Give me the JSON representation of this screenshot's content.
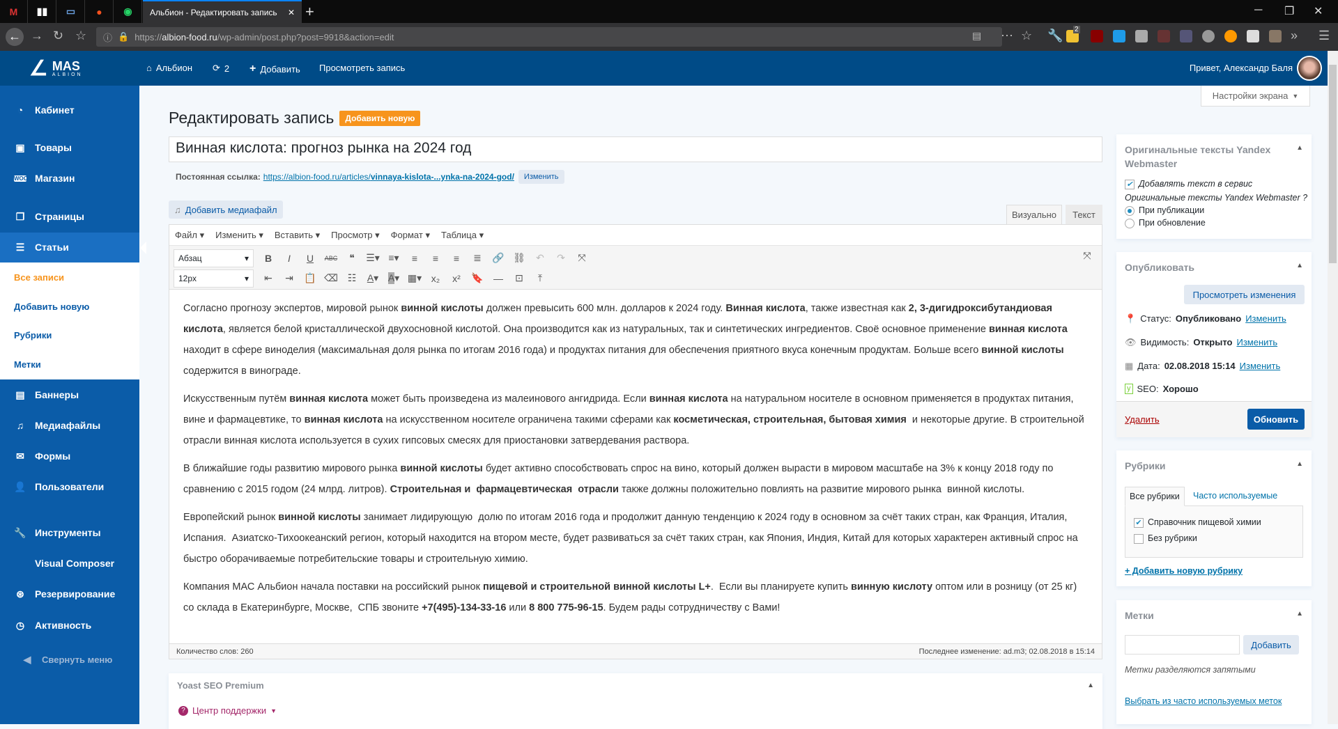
{
  "browser": {
    "tab_title": "Альбион - Редактировать запись",
    "url_prefix": "https://",
    "url_host": "albion-food.ru",
    "url_path": "/wp-admin/post.php?post=9918&action=edit",
    "ext_badge": "2"
  },
  "adminbar": {
    "logo_main": "MAS",
    "logo_sub": "ALBION",
    "site": "Альбион",
    "updates": "2",
    "add": "Добавить",
    "view": "Просмотреть запись",
    "greeting": "Привет, Александр Баля"
  },
  "sidebar": {
    "items": [
      {
        "label": "Кабинет"
      },
      {
        "label": "Товары"
      },
      {
        "label": "Магазин"
      },
      {
        "label": "Страницы"
      },
      {
        "label": "Статьи"
      },
      {
        "label": "Баннеры"
      },
      {
        "label": "Медиафайлы"
      },
      {
        "label": "Формы"
      },
      {
        "label": "Пользователи"
      },
      {
        "label": "Инструменты"
      },
      {
        "label": "Visual Composer"
      },
      {
        "label": "Резервирование"
      },
      {
        "label": "Активность"
      }
    ],
    "submenu": [
      "Все записи",
      "Добавить новую",
      "Рубрики",
      "Метки"
    ],
    "collapse": "Свернуть меню"
  },
  "screen_options": "Настройки экрана",
  "page": {
    "title": "Редактировать запись",
    "add_new": "Добавить новую",
    "post_title": "Винная кислота: прогноз рынка на 2024 год",
    "permalink_label": "Постоянная ссылка:",
    "permalink_base": "https://albion-food.ru/articles/",
    "permalink_slug": "vinnaya-kislota-...ynka-na-2024-god/",
    "permalink_edit": "Изменить",
    "add_media": "Добавить медиафайл"
  },
  "editor": {
    "tab_visual": "Визуально",
    "tab_text": "Текст",
    "menus": [
      "Файл",
      "Изменить",
      "Вставить",
      "Просмотр",
      "Формат",
      "Таблица"
    ],
    "format": "Абзац",
    "fontsize": "12px",
    "word_count": "Количество слов: 260",
    "last_edit": "Последнее изменение: ad.m3; 02.08.2018 в 15:14",
    "paragraphs": [
      "Согласно прогнозу экспертов, мировой рынок <b>винной кислоты</b> должен превысить 600 млн. долларов к 2024 году. <b>Винная кислота</b>, также известная как <b>2, 3-дигидроксибутандиовая кислота</b>, является белой кристаллической двухосновной кислотой. Она производится как из натуральных, так и синтетических ингредиентов. Своё основное применение <b>винная кислота</b> находит в сфере виноделия (максимальная доля рынка по итогам 2016 года) и продуктах питания для обеспечения приятного вкуса конечным продуктам. Больше всего <b>винной кислоты</b> содержится в винограде.",
      "Искусственным путём <b>винная кислота</b> может быть произведена из малеинового ангидрида. Если <b>винная кислота</b> на натуральном носителе в основном применяется в продуктах питания, вине и фармацевтике, то <b>винная кислота</b> на искусственном носителе ограничена такими сферами как <b>косметическая, строительная, бытовая химия</b>&nbsp; и некоторые другие. В строительной отрасли винная кислота используется в сухих гипсовых смесях для приостановки затвердевания раствора.",
      "В ближайшие годы развитию мирового рынка <b>винной кислоты</b> будет активно способствовать спрос на вино, который должен вырасти в мировом масштабе на 3% к концу 2018 году по сравнению с 2015 годом (24 млрд. литров). <b>Строительная и&nbsp; фармацевтическая&nbsp; отрасли</b> также должны положительно повлиять на развитие мирового рынка&nbsp; винной кислоты.",
      "Европейский рынок <b>винной кислоты</b> занимает лидирующую&nbsp; долю по итогам 2016 года и продолжит данную тенденцию к 2024 году в основном за счёт таких стран, как Франция, Италия, Испания.&nbsp; Азиатско-Тихоокеанский регион, который находится на втором месте, будет развиваться за счёт таких стран, как Япония, Индия, Китай для которых характерен активный спрос на быстро оборачиваемые потребительские товары и строительную химию.",
      "Компания МАС Альбион начала поставки на российский рынок <b>пищевой и строительной винной кислоты L+</b>.&nbsp; Если вы планируете купить <b>винную кислоту</b> оптом или в розницу (от 25 кг) со склада в Екатеринбурге, Москве,&nbsp; СПБ звоните <b>+7(495)-134-33-16</b> или <b>8 800 775-96-15</b>. Будем рады сотрудничеству с Вами!"
    ]
  },
  "yoast": {
    "title": "Yoast SEO Premium",
    "support": "Центр поддержки"
  },
  "yandex": {
    "title": "Оригинальные тексты Yandex Webmaster",
    "checkbox": "Добавлять текст в сервис",
    "question": "Оригинальные тексты Yandex Webmaster ?",
    "opt1": "При публикации",
    "opt2": "При обновление"
  },
  "publish": {
    "title": "Опубликовать",
    "preview": "Просмотреть изменения",
    "status_label": "Статус:",
    "status": "Опубликовано",
    "visibility_label": "Видимость:",
    "visibility": "Открыто",
    "date_label": "Дата:",
    "date": "02.08.2018 15:14",
    "change": "Изменить",
    "seo_label": "SEO:",
    "seo": "Хорошо",
    "delete": "Удалить",
    "update": "Обновить"
  },
  "categories": {
    "title": "Рубрики",
    "tab_all": "Все рубрики",
    "tab_popular": "Часто используемые",
    "items": [
      {
        "label": "Справочник пищевой химии",
        "checked": true
      },
      {
        "label": "Без рубрики",
        "checked": false
      }
    ],
    "add": "+ Добавить новую рубрику"
  },
  "tags": {
    "title": "Метки",
    "add": "Добавить",
    "hint": "Метки разделяются запятыми",
    "choose": "Выбрать из часто используемых меток"
  }
}
